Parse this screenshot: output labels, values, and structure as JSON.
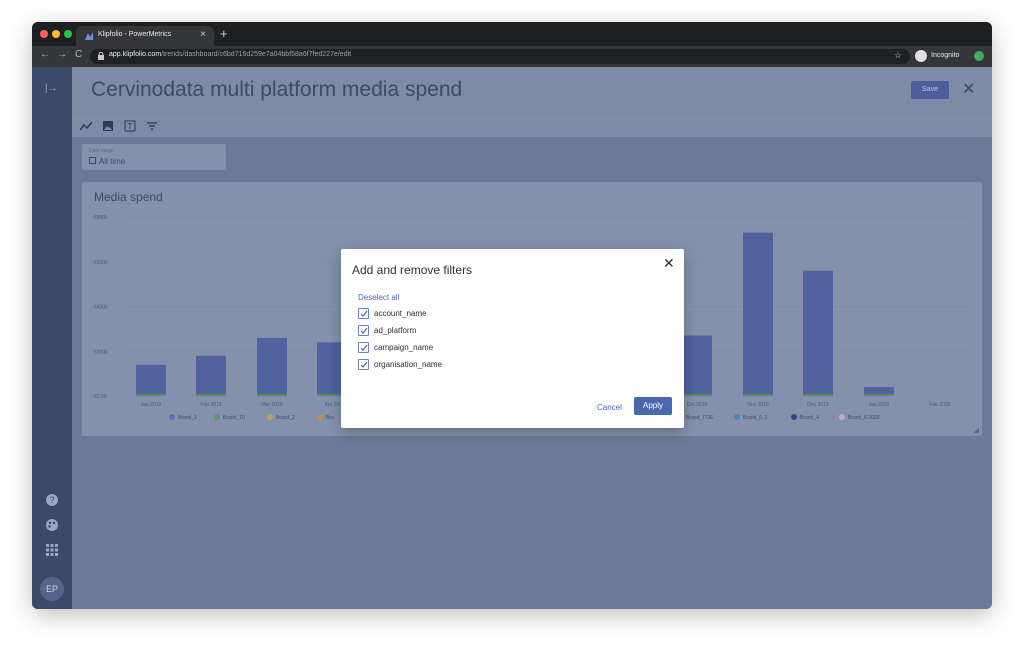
{
  "browser": {
    "tab_title": "Klipfolio - PowerMetrics",
    "url_host": "app.klipfolio.com",
    "url_path": "/trends/dashboard/c6bd716d259e7a04bbf58a6f7fed227e/edit",
    "profile_label": "Incognito"
  },
  "header": {
    "title": "Cervinodata multi platform media spend",
    "save_label": "Save"
  },
  "toolbar": {
    "icons": [
      "line-chart-icon",
      "image-icon",
      "text-icon",
      "filter-icon"
    ]
  },
  "date_range": {
    "label": "Date range",
    "value": "All time"
  },
  "sidebar": {
    "avatar_initials": "EP",
    "icons": [
      "expand-icon",
      "help-icon",
      "palette-icon",
      "apps-grid-icon"
    ]
  },
  "chart_data": {
    "type": "bar",
    "title": "Media spend",
    "y_ticks": [
      "€800k",
      "€600k",
      "€400k",
      "€200k",
      "€0.00"
    ],
    "ylim": [
      0,
      800000
    ],
    "categories": [
      "Jan 2019",
      "Feb 2019",
      "Mar 2019",
      "Apr 20",
      "Oct 2019",
      "Nov 2019",
      "Dec 2019",
      "Jan 2020",
      "Feb 2020"
    ],
    "series": [
      {
        "name": "Brand_1",
        "values": [
          140000,
          180000,
          260000,
          240000,
          270000,
          730000,
          560000,
          40000,
          0
        ]
      }
    ],
    "legend": [
      "Brand_1",
      "Brand_10",
      "Brand_2",
      "Bra",
      "Brand_7 DE",
      "Brand_6_1",
      "Brand_4",
      "Brand_6 2020"
    ],
    "legend_colors": [
      "#5b74b8",
      "#5a9a6a",
      "#c2a14e",
      "#c98a4a",
      "#6f8fd0",
      "#4a86c0",
      "#2d4a86",
      "#c9a5c9"
    ],
    "grid": true
  },
  "modal": {
    "title": "Add and remove filters",
    "deselect_label": "Deselect all",
    "filters": [
      {
        "label": "account_name",
        "checked": true
      },
      {
        "label": "ad_platform",
        "checked": true
      },
      {
        "label": "campaign_name",
        "checked": true
      },
      {
        "label": "organisation_name",
        "checked": true
      }
    ],
    "cancel_label": "Cancel",
    "apply_label": "Apply"
  },
  "colors": {
    "accent": "#4a68b0",
    "sidebar": "#3c4a6a",
    "bar": "#50639e"
  }
}
